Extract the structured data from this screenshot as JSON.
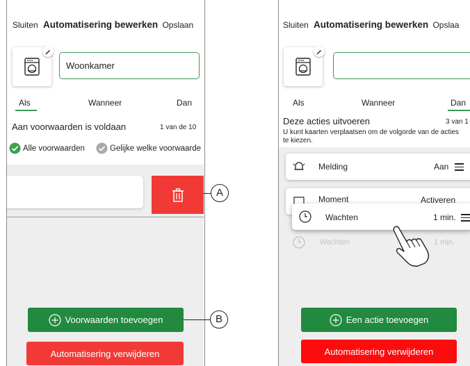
{
  "left": {
    "header": {
      "close": "Sluiten",
      "title": "Automatisering bewerken",
      "save": "Opslaan"
    },
    "name_value": "Woonkamer",
    "tabs": [
      "Als",
      "Wanneer",
      "Dan"
    ],
    "active_tab": "Als",
    "condition_title": "Aan voorwaarden is voldaan",
    "condition_count": "1 van de 10",
    "options": {
      "all": "Alle voorwaarden",
      "any": "Gelijke welke voorwaarde"
    },
    "add_button": "Voorwaarden toevoegen",
    "delete_button": "Automatisering verwijderen"
  },
  "right": {
    "header": {
      "close": "Sluiten",
      "title": "Automatisering bewerken",
      "save": "Opslaa"
    },
    "name_value": "",
    "tabs": [
      "Als",
      "Wanneer",
      "Dan"
    ],
    "active_tab": "Dan",
    "actions_title": "Deze acties uitvoeren",
    "actions_count": "3 van 1",
    "hint": "U kunt kaarten verplaatsen om de volgorde van de acties te kiezen.",
    "actions": [
      {
        "label": "Melding",
        "value": "Aan",
        "icon": "bell-icon"
      },
      {
        "label": "Moment",
        "value": "Activeren",
        "icon": "scene-icon"
      },
      {
        "label": "Wachten",
        "value": "1 min.",
        "icon": "clock-icon"
      }
    ],
    "dragging": {
      "label": "Wachten",
      "value": "1 min.",
      "icon": "clock-icon"
    },
    "add_button": "Een actie toevoegen",
    "delete_button": "Automatisering verwijderen"
  },
  "callouts": {
    "a": "A",
    "b": "B"
  },
  "colors": {
    "green": "#218a3f",
    "red": "#f13a35",
    "accent_line": "#3a9b57",
    "gray_bg": "#eeeeee"
  }
}
